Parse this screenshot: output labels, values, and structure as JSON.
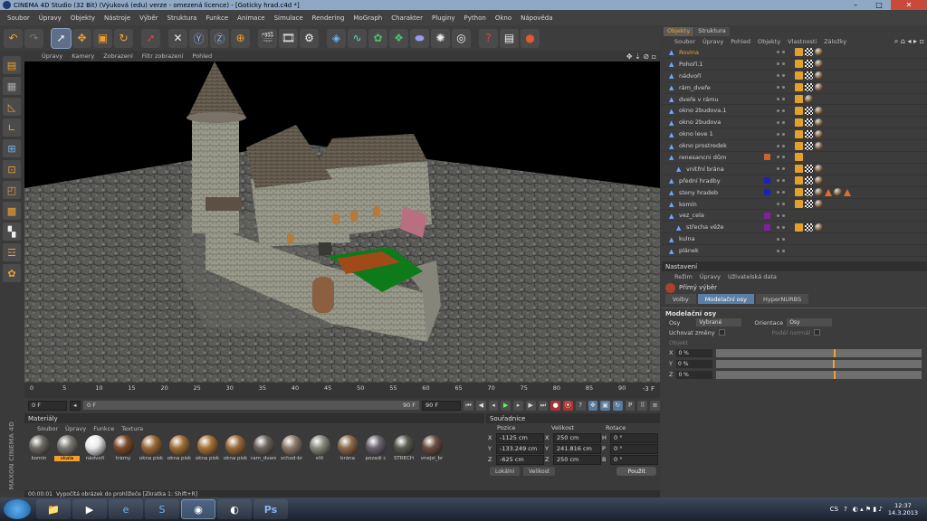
{
  "window": {
    "title": "CINEMA 4D Studio (32 Bit) (Výuková (edu) verze - omezená licence) - [Goticky hrad.c4d *]"
  },
  "menu": [
    "Soubor",
    "Úpravy",
    "Objekty",
    "Nástroje",
    "Výběr",
    "Struktura",
    "Funkce",
    "Animace",
    "Simulace",
    "Rendering",
    "MoGraph",
    "Charakter",
    "Pluginy",
    "Python",
    "Okno",
    "Nápověda"
  ],
  "toolbar": {
    "icons": [
      "undo-icon",
      "redo-icon",
      "live-select-icon",
      "move-icon",
      "scale-icon",
      "rotate-icon",
      "model-mode-icon",
      "x-axis-icon",
      "y-axis-icon",
      "z-axis-icon",
      "coordinate-system-icon",
      "render-view-icon",
      "render-picture-viewer-icon",
      "render-settings-icon",
      "cube-icon",
      "spline-icon",
      "nurbs-icon",
      "array-icon",
      "deformer-icon",
      "environment-icon",
      "camera-icon",
      "light-icon",
      "script-icon",
      "help-icon"
    ]
  },
  "viewport": {
    "menu": [
      "Úpravy",
      "Kamery",
      "Zobrazení",
      "Filtr zobrazení",
      "Pohled"
    ]
  },
  "timeline": {
    "ticks": [
      "0",
      "5",
      "10",
      "15",
      "20",
      "25",
      "30",
      "35",
      "40",
      "45",
      "50",
      "55",
      "60",
      "65",
      "70",
      "75",
      "80",
      "85",
      "90"
    ],
    "end_label": "-3 F",
    "start_field": "0 F",
    "current_field": "0 F",
    "end_field": "90 F",
    "max_field": "90 F"
  },
  "materials": {
    "title": "Materiály",
    "menu": [
      "Soubor",
      "Úpravy",
      "Funkce",
      "Textura"
    ],
    "items": [
      {
        "label": "komin",
        "color": "#6d6a64"
      },
      {
        "label": "skala",
        "color": "#7a7872",
        "selected": true
      },
      {
        "label": "nádvoří",
        "color": "#e9e9e9"
      },
      {
        "label": "trámy",
        "color": "#7a4a2a"
      },
      {
        "label": "okna pisk",
        "color": "#9a6a3a"
      },
      {
        "label": "okna pisk",
        "color": "#a06e38"
      },
      {
        "label": "okna pisk",
        "color": "#a87238"
      },
      {
        "label": "okna pisk",
        "color": "#9a6a3a"
      },
      {
        "label": "ram_dvere",
        "color": "#6d645c"
      },
      {
        "label": "vchod-br",
        "color": "#8c7a6a"
      },
      {
        "label": "stit",
        "color": "#8a8a80"
      },
      {
        "label": "brána",
        "color": "#8c6a4a"
      },
      {
        "label": "pozadi c",
        "color": "#6a6470"
      },
      {
        "label": "STRECH",
        "color": "#5a5a50"
      },
      {
        "label": "vnejsi_br",
        "color": "#6a4e44"
      }
    ]
  },
  "coords": {
    "title": "Souřadnice",
    "col_headers": [
      "Pozice",
      "Velikost",
      "Rotace"
    ],
    "rows": [
      {
        "axis": "X",
        "pos": "-1125 cm",
        "size_axis": "X",
        "size": "250 cm",
        "rot_axis": "H",
        "rot": "0 °"
      },
      {
        "axis": "Y",
        "pos": "-133.249 cm",
        "size_axis": "Y",
        "size": "241.816 cm",
        "rot_axis": "P",
        "rot": "0 °"
      },
      {
        "axis": "Z",
        "pos": "-625 cm",
        "size_axis": "Z",
        "size": "250 cm",
        "rot_axis": "B",
        "rot": "0 °"
      }
    ],
    "mode": "Lokální",
    "size_mode": "Velikost",
    "apply": "Použít"
  },
  "status": {
    "time": "00:00:01",
    "message": "Vypočítá obrázek do prohlížeče [Zkratka 1: Shift+R]"
  },
  "objects": {
    "tabs": [
      "Objekty",
      "Struktura"
    ],
    "menu": [
      "Soubor",
      "Úpravy",
      "Pohled",
      "Objekty",
      "Vlastnosti",
      "Záložky"
    ],
    "rows": [
      {
        "name": "Rovina",
        "selected": true,
        "indent": 0,
        "swatch": "",
        "tags": [
          "phong",
          "checker",
          "ball"
        ]
      },
      {
        "name": "Pohoří.1",
        "indent": 0,
        "swatch": "",
        "tags": [
          "phong",
          "checker",
          "ball"
        ]
      },
      {
        "name": "nádvoří",
        "indent": 0,
        "swatch": "",
        "tags": [
          "phong",
          "checker",
          "ball"
        ]
      },
      {
        "name": "rám_dveře",
        "indent": 0,
        "swatch": "",
        "tags": [
          "phong",
          "checker",
          "ball"
        ]
      },
      {
        "name": "dveře v rámu",
        "indent": 0,
        "swatch": "",
        "tags": [
          "phong",
          "ball"
        ]
      },
      {
        "name": "okno 2budova.1",
        "indent": 0,
        "swatch": "",
        "tags": [
          "phong",
          "checker",
          "ball"
        ]
      },
      {
        "name": "okno 2budova",
        "indent": 0,
        "swatch": "",
        "tags": [
          "phong",
          "checker",
          "ball"
        ]
      },
      {
        "name": "okno leve 1",
        "indent": 0,
        "swatch": "",
        "tags": [
          "phong",
          "checker",
          "ball"
        ]
      },
      {
        "name": "okno prostredek",
        "indent": 0,
        "swatch": "",
        "tags": [
          "phong",
          "checker",
          "ball"
        ]
      },
      {
        "name": "renesancni dům",
        "indent": 0,
        "swatch": "#d06030",
        "tags": [
          "phong"
        ]
      },
      {
        "name": "vnitřní brána",
        "indent": 1,
        "swatch": "",
        "tags": [
          "phong",
          "checker",
          "ball"
        ]
      },
      {
        "name": "přední hradby",
        "indent": 0,
        "swatch": "#2020c0",
        "tags": [
          "phong",
          "checker",
          "ball"
        ]
      },
      {
        "name": "steny hradeb",
        "indent": 0,
        "swatch": "#2020c0",
        "tags": [
          "phong",
          "checker",
          "ball",
          "tri",
          "ball",
          "tri"
        ]
      },
      {
        "name": "komín",
        "indent": 0,
        "swatch": "",
        "tags": [
          "phong",
          "checker",
          "ball"
        ]
      },
      {
        "name": "vez_cela",
        "indent": 0,
        "swatch": "#8020a0",
        "tags": []
      },
      {
        "name": "střecha věže",
        "indent": 1,
        "swatch": "#8020a0",
        "tags": [
          "phong",
          "checker",
          "ball"
        ]
      },
      {
        "name": "kulna",
        "indent": 0,
        "swatch": "",
        "tags": []
      },
      {
        "name": "plánek",
        "indent": 0,
        "swatch": "",
        "tags": []
      }
    ]
  },
  "attributes": {
    "title": "Nastavení",
    "menu": [
      "Režim",
      "Úpravy",
      "Uživatelská data"
    ],
    "mode": "Přímý výběr",
    "tabs": [
      "Volby",
      "Modelační osy",
      "HyperNURBS"
    ],
    "active_tab": "Modelační osy",
    "section": "Modelační osy",
    "osy_label": "Osy",
    "osy_value": "Vybrané",
    "orient_label": "Orientace",
    "orient_value": "Osy",
    "keep_label": "Uchovat změny",
    "normal_label": "Podél normál",
    "object_label": "Objekt",
    "values": [
      {
        "axis": "X",
        "value": "0 %"
      },
      {
        "axis": "Y",
        "value": "0 %"
      },
      {
        "axis": "Z",
        "value": "0 %"
      }
    ]
  },
  "taskbar": {
    "apps": [
      "explorer-icon",
      "media-player-icon",
      "ie-icon",
      "skype-icon",
      "cinema4d-icon",
      "browser-icon",
      "photoshop-icon"
    ],
    "lang": "CS",
    "time": "12:37",
    "date": "14.3.2013"
  },
  "colors": {
    "accent": "#f0a030",
    "selection": "#5a7ea6"
  }
}
